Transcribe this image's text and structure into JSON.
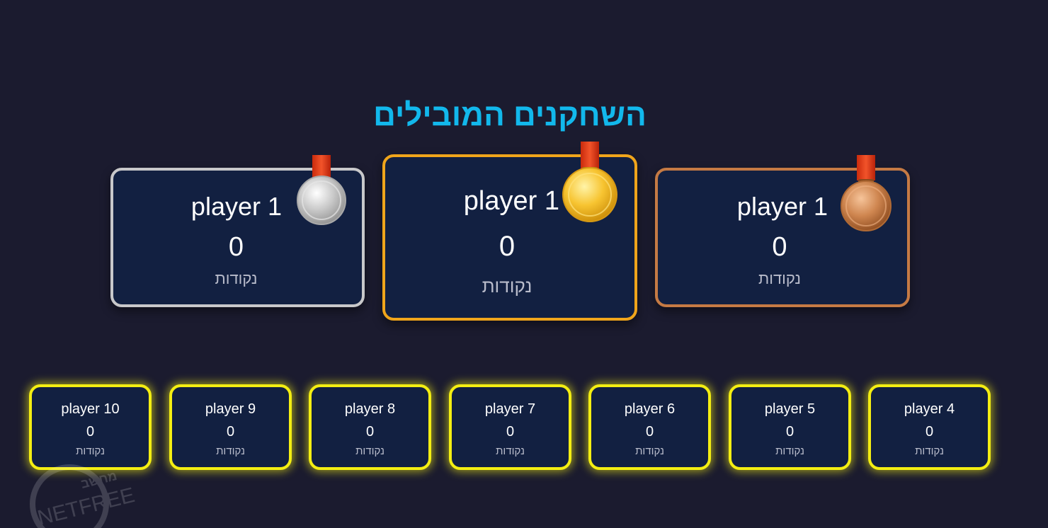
{
  "leaderboard": {
    "title": "השחקנים המובילים",
    "podium": [
      {
        "rank": 2,
        "name": "player 1",
        "score": "0",
        "label": "נקודות",
        "medal": "silver-medal"
      },
      {
        "rank": 1,
        "name": "player 1",
        "score": "0",
        "label": "נקודות",
        "medal": "gold-medal"
      },
      {
        "rank": 3,
        "name": "player 1",
        "score": "0",
        "label": "נקודות",
        "medal": "bronze-medal"
      }
    ],
    "others": [
      {
        "name": "player 10",
        "score": "0",
        "label": "נקודות"
      },
      {
        "name": "player 9",
        "score": "0",
        "label": "נקודות"
      },
      {
        "name": "player 8",
        "score": "0",
        "label": "נקודות"
      },
      {
        "name": "player 7",
        "score": "0",
        "label": "נקודות"
      },
      {
        "name": "player 6",
        "score": "0",
        "label": "נקודות"
      },
      {
        "name": "player 5",
        "score": "0",
        "label": "נקודות"
      },
      {
        "name": "player 4",
        "score": "0",
        "label": "נקודות"
      }
    ]
  },
  "watermark": {
    "top": "מחשב",
    "main": "NETFREE"
  },
  "colors": {
    "background": "#1b1b2f",
    "title": "#12b8ec",
    "card": "#122041",
    "gold_border": "#f0a51b",
    "silver_border": "#c8c8ca",
    "bronze_border": "#c57a44",
    "highlight_border": "#f4ee12"
  }
}
